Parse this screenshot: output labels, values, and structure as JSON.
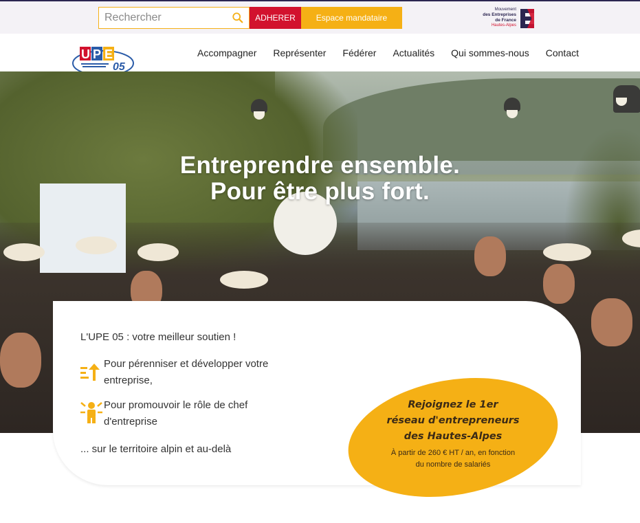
{
  "topbar": {
    "search_placeholder": "Rechercher",
    "adherer_label": "ADHERER",
    "espace_label": "Espace mandataire",
    "partner_line1": "Mouvement",
    "partner_line2": "des Entreprises",
    "partner_line3": "de France",
    "partner_line4": "Hautes-Alpes"
  },
  "nav": {
    "items": [
      "Accompagner",
      "Représenter",
      "Fédérer",
      "Actualités",
      "Qui sommes-nous",
      "Contact"
    ]
  },
  "hero": {
    "title_line1": "Entreprendre ensemble.",
    "title_line2": "Pour être plus fort."
  },
  "card": {
    "intro": "L'UPE 05 : votre meilleur soutien !",
    "point1": "Pour pérenniser et développer votre entreprise,",
    "point2": "Pour promouvoir le rôle de chef d'entreprise",
    "outro": "... sur le territoire alpin et au-delà"
  },
  "promo": {
    "line1": "Rejoignez le 1er",
    "line2": "réseau d'entrepreneurs",
    "line3": "des Hautes-Alpes",
    "sub1": "À partir de 260 € HT / an, en fonction",
    "sub2": "du nombre de salariés"
  },
  "colors": {
    "accent": "#f5b015",
    "red": "#d2122e",
    "navy": "#2b2550",
    "blue": "#2a5ba8"
  },
  "icons": [
    "search-icon",
    "growth-icon",
    "leader-icon",
    "upe-logo",
    "medef-logo"
  ]
}
